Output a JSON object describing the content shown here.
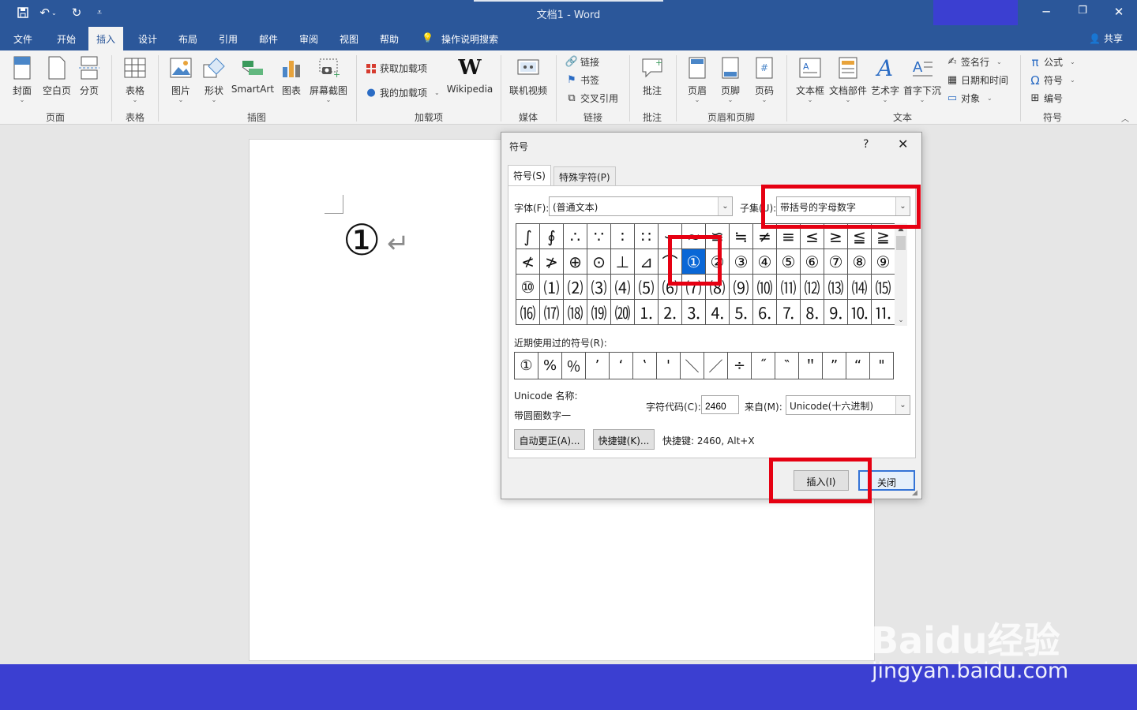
{
  "window": {
    "title": "文档1  -  Word"
  },
  "quick_access": [
    "save-icon",
    "undo-icon",
    "redo-icon",
    "customize-icon"
  ],
  "tabs": [
    "文件",
    "开始",
    "插入",
    "设计",
    "布局",
    "引用",
    "邮件",
    "审阅",
    "视图",
    "帮助"
  ],
  "active_tab": "插入",
  "tell_me": "操作说明搜索",
  "share": "共享",
  "ribbon": {
    "cover": "封面",
    "blank_page": "空白页",
    "page_break": "分页",
    "table": "表格",
    "pictures": "图片",
    "shapes": "形状",
    "smartart": "SmartArt",
    "chart": "图表",
    "screenshot": "屏幕截图",
    "get_addins": "获取加载项",
    "my_addins": "我的加载项",
    "wikipedia": "Wikipedia",
    "online_video": "联机视频",
    "link": "链接",
    "bookmark": "书签",
    "cross_ref": "交叉引用",
    "comment": "批注",
    "header": "页眉",
    "footer": "页脚",
    "page_number": "页码",
    "textbox": "文本框",
    "quick_parts": "文档部件",
    "wordart": "艺术字",
    "dropcap": "首字下沉",
    "signature_line": "签名行",
    "datetime": "日期和时间",
    "object": "对象",
    "equation": "公式",
    "symbol": "符号",
    "number": "编号"
  },
  "groups": [
    "页面",
    "表格",
    "插图",
    "加载项",
    "媒体",
    "链接",
    "批注",
    "页眉和页脚",
    "文本",
    "符号"
  ],
  "document": {
    "inserted_symbol": "①"
  },
  "dialog": {
    "title": "符号",
    "help": "?",
    "close_x": "✕",
    "tab_symbols": "符号(S)",
    "tab_special": "特殊字符(P)",
    "font_label": "字体(F):",
    "font_value": "(普通文本)",
    "subset_label": "子集(U):",
    "subset_value": "带括号的字母数字",
    "symbols": [
      "∫",
      "∮",
      "∴",
      "∵",
      "∶",
      "∷",
      "∽",
      "≈",
      "≌",
      "≒",
      "≠",
      "≡",
      "≤",
      "≥",
      "≦",
      "≧",
      "≮",
      "≯",
      "⊕",
      "⊙",
      "⊥",
      "⊿",
      "⌒",
      "①",
      "②",
      "③",
      "④",
      "⑤",
      "⑥",
      "⑦",
      "⑧",
      "⑨",
      "⑩",
      "⑴",
      "⑵",
      "⑶",
      "⑷",
      "⑸",
      "⑹",
      "⑺",
      "⑻",
      "⑼",
      "⑽",
      "⑾",
      "⑿",
      "⒀",
      "⒁",
      "⒂",
      "⒃",
      "⒄",
      "⒅",
      "⒆",
      "⒇",
      "⒈",
      "⒉",
      "⒊",
      "⒋",
      "⒌",
      "⒍",
      "⒎",
      "⒏",
      "⒐",
      "⒑",
      "⒒"
    ],
    "selected_index": 23,
    "recent_label": "近期使用过的符号(R):",
    "recent": [
      "①",
      "%",
      "％",
      "’",
      "‘",
      "‛",
      "'",
      "＼",
      "／",
      "÷",
      "˝",
      "‶",
      "＂",
      "”",
      "“",
      "\""
    ],
    "unicode_name_label": "Unicode 名称:",
    "unicode_name": "带圆圈数字一",
    "char_code_label": "字符代码(C):",
    "char_code": "2460",
    "from_label": "来自(M):",
    "from_value": "Unicode(十六进制)",
    "autocorrect_btn": "自动更正(A)...",
    "shortcut_btn": "快捷键(K)...",
    "shortcut_text": "快捷键: 2460, Alt+X",
    "insert_btn": "插入(I)",
    "close_btn": "关闭"
  },
  "watermark": {
    "brand": "Baidu经验",
    "url": "jingyan.baidu.com"
  }
}
